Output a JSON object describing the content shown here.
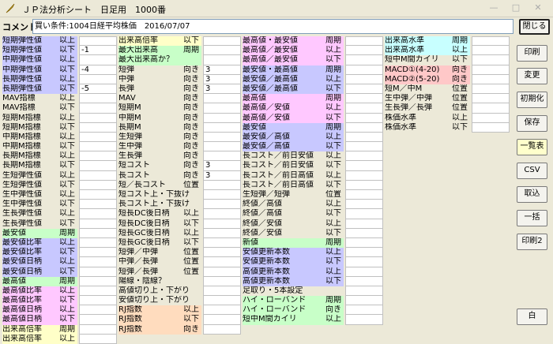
{
  "window": {
    "title": "ＪＰ法分析シート　日足用　1000番",
    "controls": [
      "—",
      "□",
      "✕"
    ]
  },
  "comment": {
    "label": "コメント",
    "value": "買い条件:1004日経平均株価　2016/07/07"
  },
  "colors": {
    "blue": "#c8c8ff",
    "green": "#c8ffc8",
    "pink": "#ffc8ff",
    "cyan": "#c8ffff",
    "salmon": "#ffc8c8",
    "orange": "#ffdcbe",
    "yellow": "#ffffc8"
  },
  "buttons": [
    {
      "label": "閉じる",
      "name": "close-button"
    },
    {
      "label": "印刷",
      "name": "print-button"
    },
    {
      "label": "変更",
      "name": "change-button"
    },
    {
      "label": "初期化",
      "name": "init-button"
    },
    {
      "label": "保存",
      "name": "save-button"
    },
    {
      "label": "一覧表",
      "name": "list-button"
    },
    {
      "label": "CSV",
      "name": "csv-button"
    },
    {
      "label": "取込",
      "name": "import-button"
    },
    {
      "label": "一括",
      "name": "batch-button"
    },
    {
      "label": "印刷2",
      "name": "print2-button"
    },
    {
      "label": "白",
      "name": "white-button"
    }
  ],
  "col1": [
    {
      "l": "短期弾性値",
      "r": "以上",
      "v": "",
      "c": "blue"
    },
    {
      "l": "短期弾性値",
      "r": "以下",
      "v": "-1",
      "c": "blue"
    },
    {
      "l": "中期弾性値",
      "r": "以上",
      "v": "",
      "c": "blue"
    },
    {
      "l": "中期弾性値",
      "r": "以下",
      "v": "-4",
      "c": "blue"
    },
    {
      "l": "長期弾性値",
      "r": "以上",
      "v": "",
      "c": "blue"
    },
    {
      "l": "長期弾性値",
      "r": "以下",
      "v": "-5",
      "c": "blue"
    },
    {
      "l": "MAV指標",
      "r": "以上",
      "v": "",
      "c": ""
    },
    {
      "l": "MAV指標",
      "r": "以下",
      "v": "",
      "c": ""
    },
    {
      "l": "短期M指標",
      "r": "以上",
      "v": "",
      "c": ""
    },
    {
      "l": "短期M指標",
      "r": "以下",
      "v": "",
      "c": ""
    },
    {
      "l": "中期M指標",
      "r": "以上",
      "v": "",
      "c": ""
    },
    {
      "l": "中期M指標",
      "r": "以下",
      "v": "",
      "c": ""
    },
    {
      "l": "長期M指標",
      "r": "以上",
      "v": "",
      "c": ""
    },
    {
      "l": "長期M指標",
      "r": "以下",
      "v": "",
      "c": ""
    },
    {
      "l": "生短弾性値",
      "r": "以上",
      "v": "",
      "c": ""
    },
    {
      "l": "生短弾性値",
      "r": "以下",
      "v": "",
      "c": ""
    },
    {
      "l": "生中弾性値",
      "r": "以上",
      "v": "",
      "c": ""
    },
    {
      "l": "生中弾性値",
      "r": "以下",
      "v": "",
      "c": ""
    },
    {
      "l": "生長弾性値",
      "r": "以上",
      "v": "",
      "c": ""
    },
    {
      "l": "生長弾性値",
      "r": "以下",
      "v": "",
      "c": ""
    },
    {
      "l": "最安値",
      "r": "周期",
      "v": "",
      "c": "green"
    },
    {
      "l": "最安値比率",
      "r": "以上",
      "v": "",
      "c": "blue"
    },
    {
      "l": "最安値比率",
      "r": "以下",
      "v": "",
      "c": "blue"
    },
    {
      "l": "最安値日柄",
      "r": "以上",
      "v": "",
      "c": "blue"
    },
    {
      "l": "最安値日柄",
      "r": "以下",
      "v": "",
      "c": "blue"
    },
    {
      "l": "最高値",
      "r": "周期",
      "v": "",
      "c": "green"
    },
    {
      "l": "最高値比率",
      "r": "以上",
      "v": "",
      "c": "pink"
    },
    {
      "l": "最高値比率",
      "r": "以下",
      "v": "",
      "c": "pink"
    },
    {
      "l": "最高値日柄",
      "r": "以上",
      "v": "",
      "c": "pink"
    },
    {
      "l": "最高値日柄",
      "r": "以下",
      "v": "",
      "c": "pink"
    },
    {
      "l": "出来高倍率",
      "r": "周期",
      "v": "",
      "c": "yellow"
    },
    {
      "l": "出来高倍率",
      "r": "以上",
      "v": "",
      "c": "yellow"
    }
  ],
  "col2": [
    {
      "l": "出来高倍率",
      "r": "以下",
      "v": "",
      "c": "yellow"
    },
    {
      "l": "最大出来高",
      "r": "周期",
      "v": "",
      "c": "green"
    },
    {
      "l": "最大出来高か？",
      "r": "",
      "v": "",
      "c": "green"
    },
    {
      "l": "短弾",
      "r": "向き",
      "v": "3",
      "c": ""
    },
    {
      "l": "中弾",
      "r": "向き",
      "v": "3",
      "c": ""
    },
    {
      "l": "長弾",
      "r": "向き",
      "v": "3",
      "c": ""
    },
    {
      "l": "MAV",
      "r": "向き",
      "v": "",
      "c": ""
    },
    {
      "l": "短期M",
      "r": "向き",
      "v": "",
      "c": ""
    },
    {
      "l": "中期M",
      "r": "向き",
      "v": "",
      "c": ""
    },
    {
      "l": "長期M",
      "r": "向き",
      "v": "",
      "c": ""
    },
    {
      "l": "生短弾",
      "r": "向き",
      "v": "",
      "c": ""
    },
    {
      "l": "生中弾",
      "r": "向き",
      "v": "",
      "c": ""
    },
    {
      "l": "生長弾",
      "r": "向き",
      "v": "",
      "c": ""
    },
    {
      "l": "短コスト",
      "r": "向き",
      "v": "3",
      "c": ""
    },
    {
      "l": "長コスト",
      "r": "向き",
      "v": "3",
      "c": ""
    },
    {
      "l": "短／長コスト",
      "r": "位置",
      "v": "",
      "c": ""
    },
    {
      "l": "短コスト上・下抜け",
      "r": "",
      "v": "",
      "c": ""
    },
    {
      "l": "長コスト上・下抜け",
      "r": "",
      "v": "",
      "c": ""
    },
    {
      "l": "短長DC後日柄",
      "r": "以上",
      "v": "",
      "c": ""
    },
    {
      "l": "短長DC後日柄",
      "r": "以下",
      "v": "",
      "c": ""
    },
    {
      "l": "短長GC後日柄",
      "r": "以上",
      "v": "",
      "c": ""
    },
    {
      "l": "短長GC後日柄",
      "r": "以下",
      "v": "",
      "c": ""
    },
    {
      "l": "短弾／中弾",
      "r": "位置",
      "v": "",
      "c": ""
    },
    {
      "l": "中弾／長弾",
      "r": "位置",
      "v": "",
      "c": ""
    },
    {
      "l": "短弾／長弾",
      "r": "位置",
      "v": "",
      "c": ""
    },
    {
      "l": "陽線・陰線？",
      "r": "",
      "v": "",
      "c": ""
    },
    {
      "l": "高値切り上・下がり",
      "r": "",
      "v": "",
      "c": ""
    },
    {
      "l": "安値切り上・下がり",
      "r": "",
      "v": "",
      "c": ""
    },
    {
      "l": "RJ指数",
      "r": "以上",
      "v": "",
      "c": "orange"
    },
    {
      "l": "RJ指数",
      "r": "以下",
      "v": "",
      "c": "orange"
    },
    {
      "l": "RJ指数",
      "r": "向き",
      "v": "",
      "c": "orange"
    }
  ],
  "col3": [
    {
      "l": "最高値・最安値",
      "r": "周期",
      "v": "",
      "c": "pink"
    },
    {
      "l": "最高値／最安値",
      "r": "以上",
      "v": "",
      "c": "pink"
    },
    {
      "l": "最高値／最安値",
      "r": "以下",
      "v": "",
      "c": "pink"
    },
    {
      "l": "最安値・最高値",
      "r": "周期",
      "v": "",
      "c": "blue"
    },
    {
      "l": "最安値／最高値",
      "r": "以上",
      "v": "",
      "c": "blue"
    },
    {
      "l": "最安値／最高値",
      "r": "以下",
      "v": "",
      "c": "blue"
    },
    {
      "l": "最高値",
      "r": "周期",
      "v": "",
      "c": "pink"
    },
    {
      "l": "最高値／安値",
      "r": "以上",
      "v": "",
      "c": "pink"
    },
    {
      "l": "最高値／安値",
      "r": "以下",
      "v": "",
      "c": "pink"
    },
    {
      "l": "最安値",
      "r": "周期",
      "v": "",
      "c": "blue"
    },
    {
      "l": "最安値／高値",
      "r": "以上",
      "v": "",
      "c": "blue"
    },
    {
      "l": "最安値／高値",
      "r": "以下",
      "v": "",
      "c": "blue"
    },
    {
      "l": "長コスト／前日安値",
      "r": "以上",
      "v": "",
      "c": ""
    },
    {
      "l": "長コスト／前日安値",
      "r": "以下",
      "v": "",
      "c": ""
    },
    {
      "l": "長コスト／前日高値",
      "r": "以上",
      "v": "",
      "c": ""
    },
    {
      "l": "長コスト／前日高値",
      "r": "以下",
      "v": "",
      "c": ""
    },
    {
      "l": "生短弾／短弾",
      "r": "位置",
      "v": "",
      "c": ""
    },
    {
      "l": "終値／高値",
      "r": "以上",
      "v": "",
      "c": ""
    },
    {
      "l": "終値／高値",
      "r": "以下",
      "v": "",
      "c": ""
    },
    {
      "l": "終値／安値",
      "r": "以上",
      "v": "",
      "c": ""
    },
    {
      "l": "終値／安値",
      "r": "以下",
      "v": "",
      "c": ""
    },
    {
      "l": "新値",
      "r": "周期",
      "v": "",
      "c": "green"
    },
    {
      "l": "安値更新本数",
      "r": "以上",
      "v": "",
      "c": "blue"
    },
    {
      "l": "安値更新本数",
      "r": "以下",
      "v": "",
      "c": "blue"
    },
    {
      "l": "高値更新本数",
      "r": "以上",
      "v": "",
      "c": "blue"
    },
    {
      "l": "高値更新本数",
      "r": "以下",
      "v": "",
      "c": "blue"
    },
    {
      "l": "足取り・5本設定",
      "r": "",
      "v": "",
      "c": ""
    },
    {
      "l": "ハイ・ローバンド",
      "r": "周期",
      "v": "",
      "c": "green"
    },
    {
      "l": "ハイ・ローバンド",
      "r": "向き",
      "v": "",
      "c": "green"
    },
    {
      "l": "短中M間カイリ",
      "r": "以上",
      "v": "",
      "c": "green"
    }
  ],
  "col4": [
    {
      "l": "出来高水準",
      "r": "周期",
      "v": "",
      "c": "cyan"
    },
    {
      "l": "出来高水準",
      "r": "以上",
      "v": "",
      "c": "cyan"
    },
    {
      "l": "短中M間カイリ",
      "r": "以下",
      "v": "",
      "c": ""
    },
    {
      "l": "MACD①(4-20)",
      "r": "向き",
      "v": "",
      "c": "salmon"
    },
    {
      "l": "MACD②(5-20)",
      "r": "向き",
      "v": "",
      "c": "salmon"
    },
    {
      "l": "短M／中M",
      "r": "位置",
      "v": "",
      "c": ""
    },
    {
      "l": "生中弾／中弾",
      "r": "位置",
      "v": "",
      "c": ""
    },
    {
      "l": "生長弾／長弾",
      "r": "位置",
      "v": "",
      "c": ""
    },
    {
      "l": "株価水準",
      "r": "以上",
      "v": "",
      "c": ""
    },
    {
      "l": "株価水準",
      "r": "以下",
      "v": "",
      "c": ""
    }
  ]
}
